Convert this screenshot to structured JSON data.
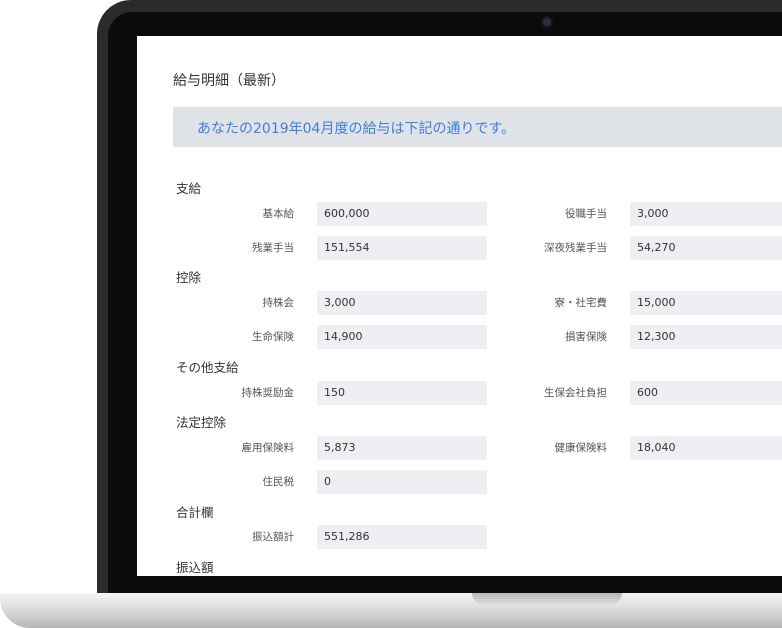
{
  "page_title": "給与明細（最新）",
  "banner_text": "あなたの2019年04月度の給与は下記の通りです。",
  "sections": {
    "payment": "支給",
    "deduction": "控除",
    "other_payment": "その他支給",
    "legal_deduction": "法定控除",
    "total": "合計欄",
    "transfer": "振込額"
  },
  "fields": {
    "base_salary": {
      "label": "基本給",
      "value": "600,000"
    },
    "position_allowance": {
      "label": "役職手当",
      "value": "3,000"
    },
    "overtime_allowance": {
      "label": "残業手当",
      "value": "151,554"
    },
    "late_night_allowance": {
      "label": "深夜残業手当",
      "value": "54,270"
    },
    "stock_association": {
      "label": "持株会",
      "value": "3,000"
    },
    "dorm_housing": {
      "label": "寮・社宅費",
      "value": "15,000"
    },
    "life_insurance": {
      "label": "生命保険",
      "value": "14,900"
    },
    "damage_insurance": {
      "label": "損害保険",
      "value": "12,300"
    },
    "stock_incentive": {
      "label": "持株奨励金",
      "value": "150"
    },
    "life_insurance_company_share": {
      "label": "生保会社負担",
      "value": "600"
    },
    "employment_insurance": {
      "label": "雇用保険料",
      "value": "5,873"
    },
    "health_insurance": {
      "label": "健康保険料",
      "value": "18,040"
    },
    "resident_tax": {
      "label": "住民税",
      "value": "0"
    },
    "transfer_total": {
      "label": "振込額計",
      "value": "551,286"
    }
  }
}
